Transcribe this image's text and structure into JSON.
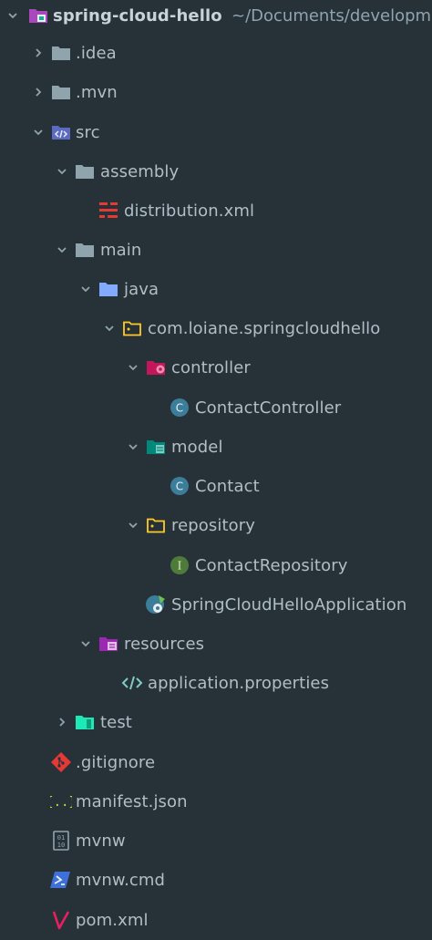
{
  "project_tree": {
    "root": {
      "name": "spring-cloud-hello",
      "path": "~/Documents/developme"
    },
    "items": {
      "idea": ".idea",
      "mvn": ".mvn",
      "src": "src",
      "assembly": "assembly",
      "distribution_xml": "distribution.xml",
      "main": "main",
      "java": "java",
      "package": "com.loiane.springcloudhello",
      "controller": "controller",
      "contact_controller": "ContactController",
      "model": "model",
      "contact": "Contact",
      "repository": "repository",
      "contact_repository": "ContactRepository",
      "application": "SpringCloudHelloApplication",
      "resources": "resources",
      "application_properties": "application.properties",
      "test": "test",
      "gitignore": ".gitignore",
      "manifest_json": "manifest.json",
      "mvnw": "mvnw",
      "mvnw_cmd": "mvnw.cmd",
      "pom_xml": "pom.xml"
    }
  },
  "icons": {
    "folder": "folder-icon",
    "src_folder": "source-folder-icon",
    "package": "package-folder-icon",
    "class": "class-icon",
    "interface": "interface-icon",
    "spring_app": "spring-boot-class-icon",
    "xml": "xml-file-icon",
    "properties": "properties-file-icon",
    "git": "git-file-icon",
    "json": "json-file-icon",
    "binary": "binary-file-icon",
    "powershell": "powershell-file-icon",
    "maven": "maven-file-icon"
  },
  "colors": {
    "background": "#263238",
    "text": "#b0bec5",
    "folder": "#90a4ae",
    "src_folder": "#5c6bc0",
    "java_folder": "#82aaff",
    "package_folder": "#ffca28",
    "controller_folder": "#e91e63",
    "model_folder": "#26a69a",
    "resources_folder": "#9c27b0",
    "test_folder": "#1de9b6",
    "class": "#3c7d9a",
    "interface": "#4e7a3a",
    "xml": "#e53935",
    "git": "#e53935",
    "maven": "#e91e63"
  }
}
